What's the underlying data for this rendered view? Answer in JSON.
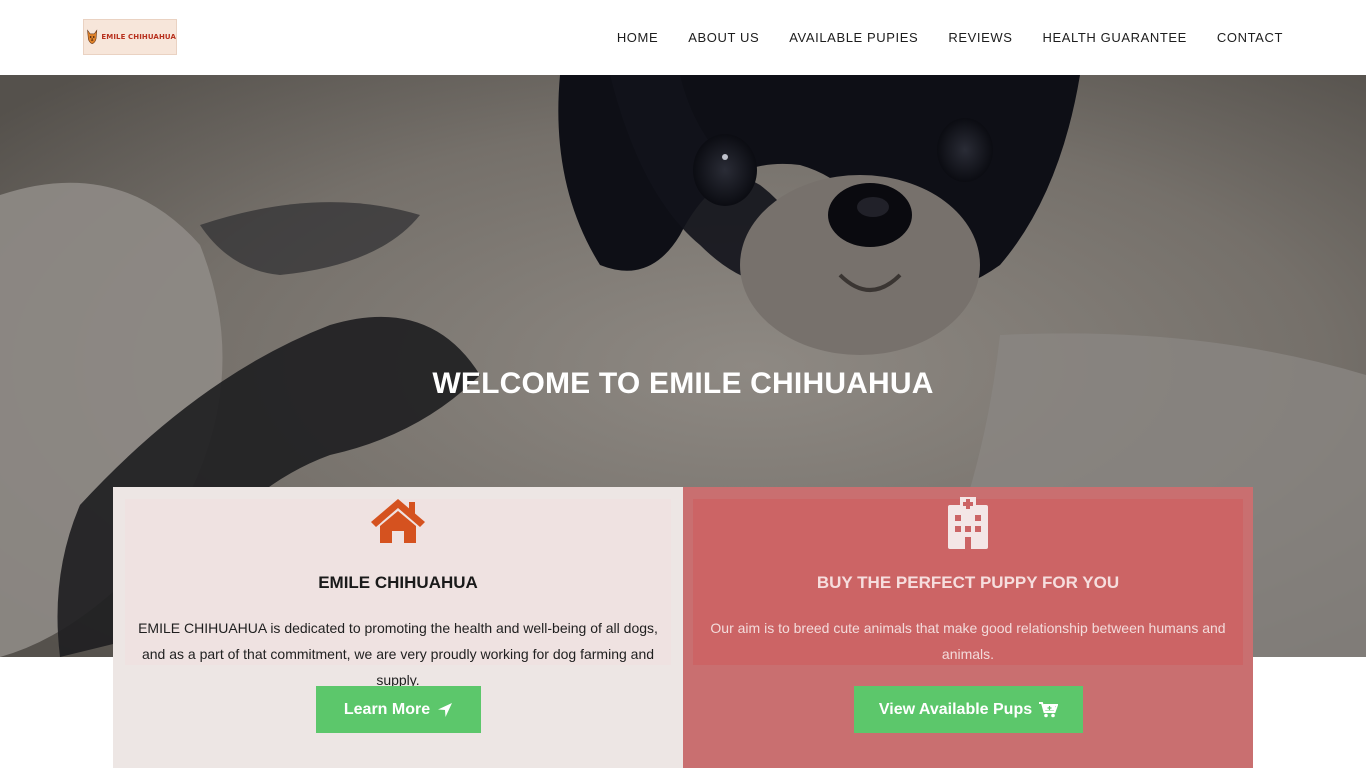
{
  "logo": {
    "text": "EMILE CHIHUAHUA",
    "icon": "chihuahua-head-icon"
  },
  "nav": {
    "items": [
      {
        "label": "HOME"
      },
      {
        "label": "ABOUT US"
      },
      {
        "label": "AVAILABLE PUPIES"
      },
      {
        "label": "REVIEWS"
      },
      {
        "label": "HEALTH GUARANTEE"
      },
      {
        "label": "CONTACT"
      }
    ]
  },
  "hero": {
    "title": "WELCOME TO EMILE CHIHUAHUA",
    "image": "chihuahua-puppy-photo"
  },
  "features": {
    "left": {
      "icon": "home-icon",
      "title": "EMILE CHIHUAHUA",
      "text": "EMILE CHIHUAHUA is dedicated to promoting the health and well-being of all dogs, and as a part of that commitment, we are very proudly working for dog farming and supply.",
      "button_label": "Learn More",
      "button_icon": "location-arrow-icon"
    },
    "right": {
      "icon": "hospital-icon",
      "title": "BUY THE PERFECT PUPPY FOR YOU",
      "text": "Our aim is to breed cute animals that make good relationship between humans and animals.",
      "button_label": "View Available Pups",
      "button_icon": "cart-icon"
    }
  },
  "colors": {
    "accent_orange": "#d5521f",
    "button_green": "#5cc76b",
    "panel_red": "#c96f70",
    "panel_light": "#ede6e4"
  }
}
